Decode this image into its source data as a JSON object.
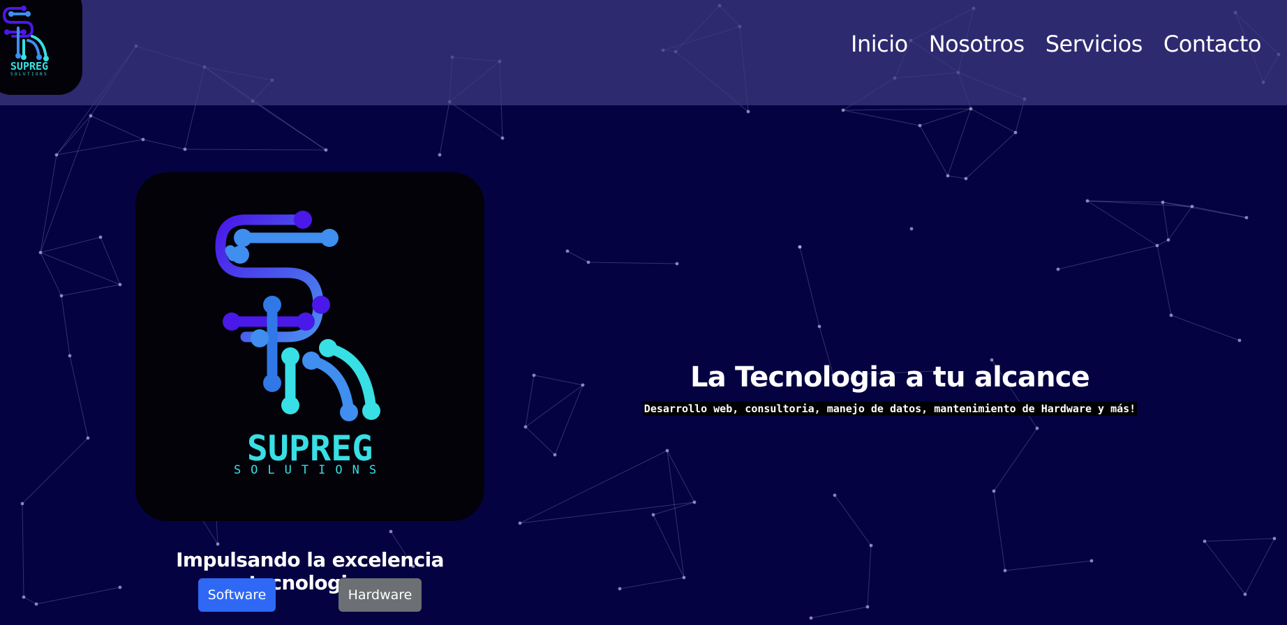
{
  "navbar": {
    "brand": {
      "logo_text": "SUPREG",
      "logo_subtext": "SOLUTIONS"
    },
    "links": [
      {
        "label": "Inicio"
      },
      {
        "label": "Nosotros"
      },
      {
        "label": "Servicios"
      },
      {
        "label": "Contacto"
      }
    ]
  },
  "hero": {
    "logo": {
      "text": "SUPREG",
      "subtext": "SOLUTIONS"
    },
    "tagline": "Impulsando la excelencia tecnologica",
    "buttons": {
      "software": "Software",
      "hardware": "Hardware"
    },
    "headline": "La Tecnologia a tu alcance",
    "subheadline": "Desarrollo web, consultoria, manejo de datos, mantenimiento de Hardware y más!"
  },
  "colors": {
    "background": "#050241",
    "navbar": "#2e2c6d",
    "logo_purple": "#4a18e8",
    "logo_blue": "#3f8ef0",
    "logo_cyan": "#38dfe4",
    "button_software": "#2e68f5",
    "button_hardware": "#6c6f73"
  },
  "icons": {
    "logo": "sr-circuit-logo-icon"
  }
}
